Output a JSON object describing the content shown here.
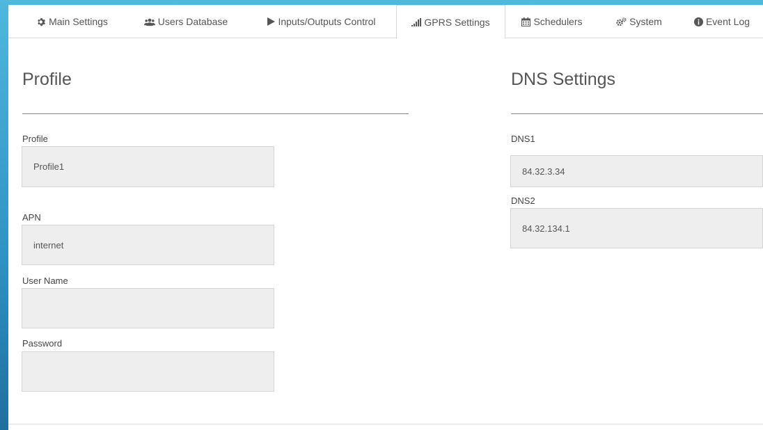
{
  "tabs": [
    {
      "label": "Main Settings",
      "icon": "gear-icon"
    },
    {
      "label": "Users Database",
      "icon": "users-icon"
    },
    {
      "label": "Inputs/Outputs Control",
      "icon": "play-icon"
    },
    {
      "label": "GPRS Settings",
      "icon": "signal-icon",
      "active": true
    },
    {
      "label": "Schedulers",
      "icon": "calendar-icon"
    },
    {
      "label": "System",
      "icon": "cogs-icon"
    },
    {
      "label": "Event Log",
      "icon": "info-icon"
    }
  ],
  "profile_section": {
    "title": "Profile",
    "fields": {
      "profile": {
        "label": "Profile",
        "value": "Profile1"
      },
      "apn": {
        "label": "APN",
        "value": "internet"
      },
      "username": {
        "label": "User Name",
        "value": ""
      },
      "password": {
        "label": "Password",
        "value": ""
      }
    }
  },
  "dns_section": {
    "title": "DNS Settings",
    "fields": {
      "dns1": {
        "label": "DNS1",
        "value": "84.32.3.34"
      },
      "dns2": {
        "label": "DNS2",
        "value": "84.32.134.1"
      }
    }
  },
  "colors": {
    "accent": "#2d93c4",
    "field_bg": "#eeeeee"
  }
}
